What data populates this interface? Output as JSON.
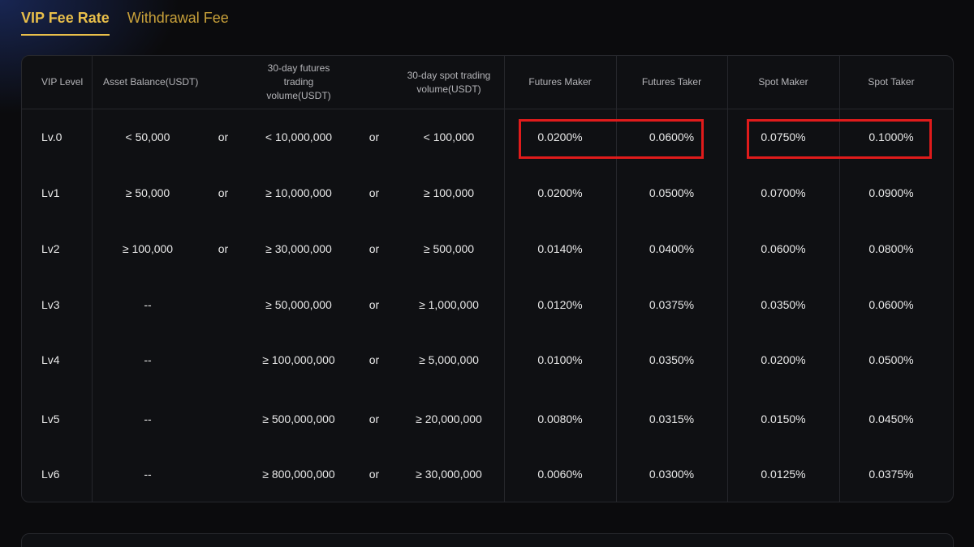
{
  "tabs": [
    {
      "label": "VIP Fee Rate",
      "active": true
    },
    {
      "label": "Withdrawal Fee",
      "active": false
    }
  ],
  "table": {
    "headers": {
      "vip_level": "VIP Level",
      "asset_balance": "Asset Balance(USDT)",
      "futures_volume": "30-day futures trading volume(USDT)",
      "spot_volume": "30-day spot trading volume(USDT)",
      "futures_maker": "Futures Maker",
      "futures_taker": "Futures Taker",
      "spot_maker": "Spot Maker",
      "spot_taker": "Spot Taker"
    },
    "rows": [
      {
        "level": "Lv.0",
        "balance": "< 50,000",
        "or1": "or",
        "futures_vol": "< 10,000,000",
        "or2": "or",
        "spot_vol": "< 100,000",
        "futures_maker": "0.0200%",
        "futures_taker": "0.0600%",
        "spot_maker": "0.0750%",
        "spot_taker": "0.1000%"
      },
      {
        "level": "Lv1",
        "balance": "≥ 50,000",
        "or1": "or",
        "futures_vol": "≥ 10,000,000",
        "or2": "or",
        "spot_vol": "≥ 100,000",
        "futures_maker": "0.0200%",
        "futures_taker": "0.0500%",
        "spot_maker": "0.0700%",
        "spot_taker": "0.0900%"
      },
      {
        "level": "Lv2",
        "balance": "≥ 100,000",
        "or1": "or",
        "futures_vol": "≥ 30,000,000",
        "or2": "or",
        "spot_vol": "≥ 500,000",
        "futures_maker": "0.0140%",
        "futures_taker": "0.0400%",
        "spot_maker": "0.0600%",
        "spot_taker": "0.0800%"
      },
      {
        "level": "Lv3",
        "balance": "--",
        "or1": "",
        "futures_vol": "≥ 50,000,000",
        "or2": "or",
        "spot_vol": "≥ 1,000,000",
        "futures_maker": "0.0120%",
        "futures_taker": "0.0375%",
        "spot_maker": "0.0350%",
        "spot_taker": "0.0600%"
      },
      {
        "level": "Lv4",
        "balance": "--",
        "or1": "",
        "futures_vol": "≥ 100,000,000",
        "or2": "or",
        "spot_vol": "≥ 5,000,000",
        "futures_maker": "0.0100%",
        "futures_taker": "0.0350%",
        "spot_maker": "0.0200%",
        "spot_taker": "0.0500%"
      },
      {
        "level": "Lv5",
        "balance": "--",
        "or1": "",
        "futures_vol": "≥ 500,000,000",
        "or2": "or",
        "spot_vol": "≥ 20,000,000",
        "futures_maker": "0.0080%",
        "futures_taker": "0.0315%",
        "spot_maker": "0.0150%",
        "spot_taker": "0.0450%"
      },
      {
        "level": "Lv6",
        "balance": "--",
        "or1": "",
        "futures_vol": "≥ 800,000,000",
        "or2": "or",
        "spot_vol": "≥ 30,000,000",
        "futures_maker": "0.0060%",
        "futures_taker": "0.0300%",
        "spot_maker": "0.0125%",
        "spot_taker": "0.0375%"
      }
    ]
  },
  "colors": {
    "accent": "#e9bf4a",
    "highlight_border": "#e01b1b",
    "background": "#0b0b0d"
  }
}
